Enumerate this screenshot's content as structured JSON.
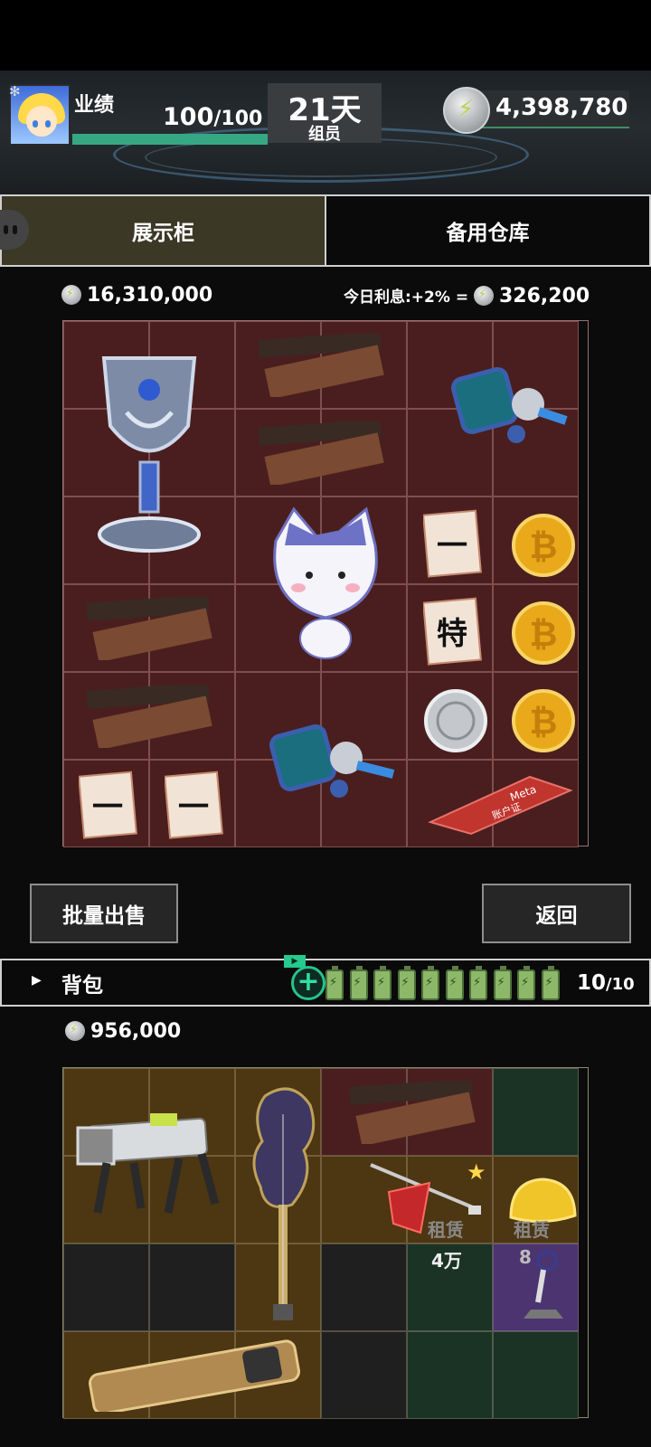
{
  "header": {
    "performance_label": "业绩",
    "performance_value": "100",
    "performance_max": "/100",
    "performance_fraction": 1.0,
    "day_count": "21天",
    "day_sub": "组员",
    "coin_total": "4,398,780",
    "icons": [
      "gear-icon",
      "energy-coin-icon"
    ]
  },
  "tabs": {
    "display_cabinet": "展示柜",
    "spare_warehouse": "备用仓库"
  },
  "display": {
    "value": "16,310,000",
    "interest_label": "今日利息:+2% =",
    "interest_value": "326,200",
    "items": [
      {
        "name": "trophy-cup",
        "icon": "trophy-icon"
      },
      {
        "name": "chocolate-bar-box",
        "icon": "chocolate-box-icon"
      },
      {
        "name": "chocolate-bar-box",
        "icon": "chocolate-box-icon"
      },
      {
        "name": "robot-figure",
        "icon": "robot-icon"
      },
      {
        "name": "cat-plush",
        "icon": "cat-plush-icon"
      },
      {
        "name": "congratulation-card",
        "icon": "card-icon",
        "text": "一"
      },
      {
        "name": "gold-bitcoin",
        "icon": "bitcoin-icon"
      },
      {
        "name": "congratulation-card",
        "icon": "card-icon",
        "text": "特"
      },
      {
        "name": "gold-bitcoin",
        "icon": "bitcoin-icon"
      },
      {
        "name": "chocolate-bar-box",
        "icon": "chocolate-box-icon"
      },
      {
        "name": "chocolate-bar-box",
        "icon": "chocolate-box-icon"
      },
      {
        "name": "silver-coin",
        "icon": "silver-coin-icon"
      },
      {
        "name": "gold-bitcoin",
        "icon": "bitcoin-icon"
      },
      {
        "name": "robot-figure",
        "icon": "robot-icon"
      },
      {
        "name": "congratulation-card",
        "icon": "card-icon",
        "text": "一"
      },
      {
        "name": "congratulation-card",
        "icon": "card-icon",
        "text": "一"
      },
      {
        "name": "meta-account-book",
        "icon": "red-book-icon",
        "text": "Meta",
        "subtext": "账户证"
      }
    ]
  },
  "buttons": {
    "batch_sell": "批量出售",
    "back": "返回"
  },
  "backpack": {
    "title": "背包",
    "battery_count": 10,
    "count": "10",
    "count_max": "/10",
    "value": "956,000",
    "rent_label": "租赁",
    "rent_price": "4万",
    "rent_price_partial": "8",
    "items": [
      {
        "name": "robot-dog",
        "icon": "robot-dog-icon"
      },
      {
        "name": "electric-guitar",
        "icon": "guitar-icon"
      },
      {
        "name": "chocolate-bar-box",
        "icon": "chocolate-box-icon"
      },
      {
        "name": "ruby-pen",
        "icon": "ruby-pen-icon",
        "starred": true
      },
      {
        "name": "golden-ingot",
        "icon": "gold-ingot-icon"
      },
      {
        "name": "keyring-stand",
        "icon": "keyring-icon"
      },
      {
        "name": "smartphone",
        "icon": "phone-icon"
      }
    ]
  },
  "colors": {
    "accent_green": "#35a883",
    "display_cell": "#4a1e1e",
    "backpack_brown": "#4d3612",
    "backpack_green": "#1b3325",
    "backpack_purple": "#4b3470"
  }
}
